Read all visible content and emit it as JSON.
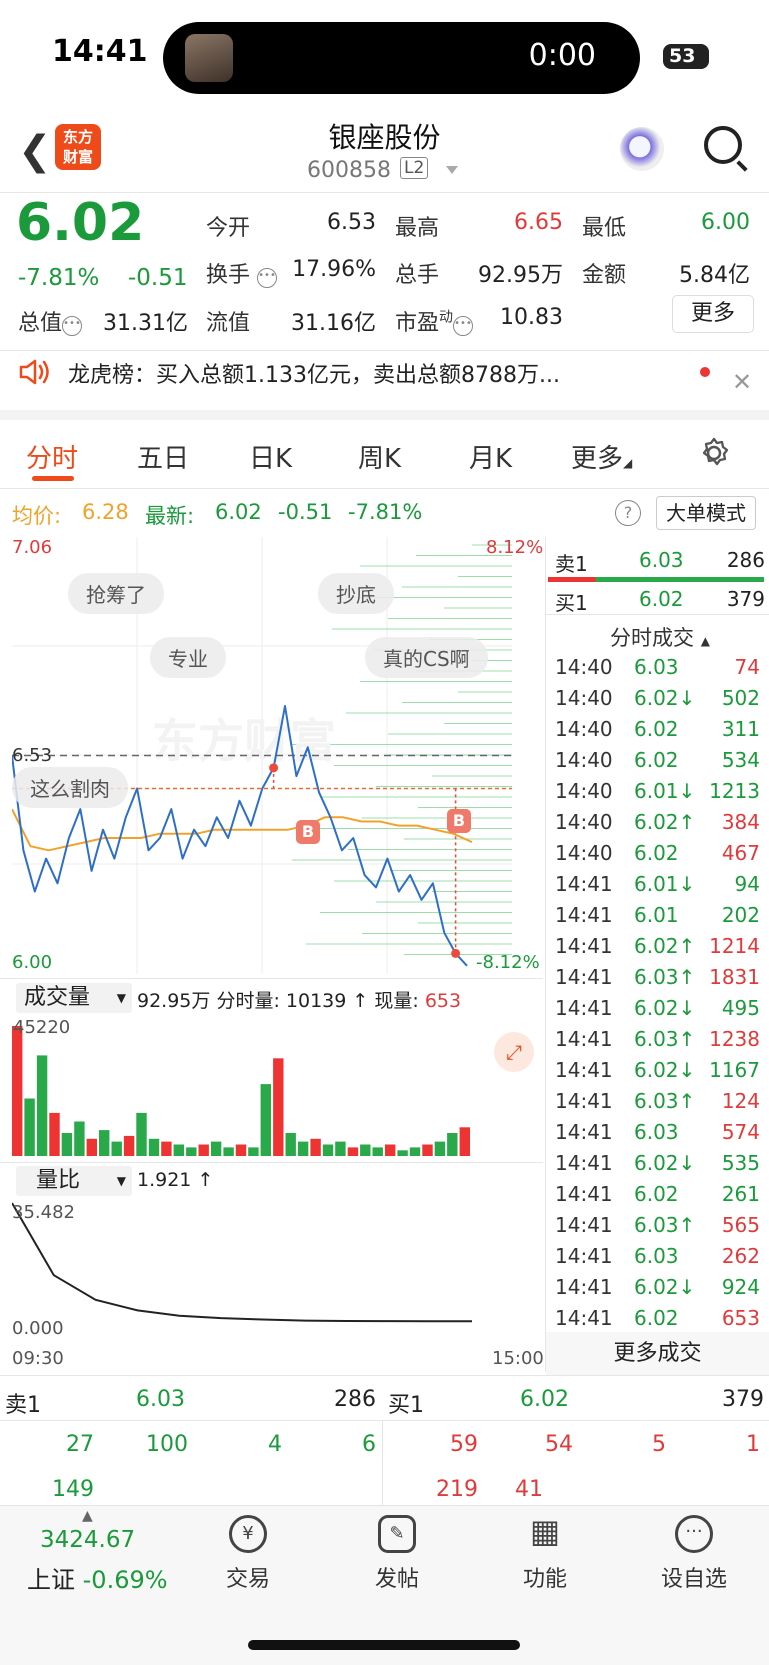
{
  "status_bar": {
    "time": "14:41",
    "timer": "0:00",
    "battery": "53"
  },
  "header": {
    "logo_line1": "东方",
    "logo_line2": "财富",
    "title": "银座股份",
    "code": "600858",
    "level": "L2"
  },
  "quote": {
    "price": "6.02",
    "change_pct": "-7.81%",
    "change": "-0.51",
    "open_label": "今开",
    "open": "6.53",
    "high_label": "最高",
    "high": "6.65",
    "low_label": "最低",
    "low": "6.00",
    "turnover_label": "换手",
    "turnover": "17.96%",
    "volume_label": "总手",
    "volume": "92.95万",
    "amount_label": "金额",
    "amount": "5.84亿",
    "mktcap_label": "总值",
    "mktcap": "31.31亿",
    "float_label": "流值",
    "float": "31.16亿",
    "pe_label": "市盈",
    "pe_sup": "动",
    "pe": "10.83",
    "more": "更多"
  },
  "notice": {
    "text": "龙虎榜：买入总额1.133亿元，卖出总额8788万..."
  },
  "tabs": [
    "分时",
    "五日",
    "日K",
    "周K",
    "月K",
    "更多"
  ],
  "chart_info": {
    "avg_label": "均价:",
    "avg": "6.28",
    "latest_label": "最新:",
    "latest": "6.02",
    "chg": "-0.51",
    "pct": "-7.81%",
    "help": "?",
    "mode": "大单模式"
  },
  "chart_labels": {
    "top_price": "7.06",
    "top_pct": "8.12%",
    "prev_close": "6.53",
    "bottom_price": "6.00",
    "bottom_pct": "-8.12%",
    "buy_marker": "B"
  },
  "bubbles": [
    "抢筹了",
    "抄底",
    "专业",
    "真的CS啊",
    "这么割肉"
  ],
  "watermark": "东方财富",
  "volume_bar": {
    "selector": "成交量",
    "total": "92.95万",
    "period_label": "分时量:",
    "period": "10139",
    "period_arrow": "↑",
    "now_label": "现量:",
    "now": "653",
    "max": "45220"
  },
  "ratio_bar": {
    "selector": "量比",
    "value": "1.921",
    "arrow": "↑",
    "max": "35.482",
    "min": "0.000"
  },
  "time_axis": {
    "start": "09:30",
    "end": "15:00"
  },
  "book": {
    "sell_label": "卖1",
    "sell_price": "6.03",
    "sell_vol": "286",
    "buy_label": "买1",
    "buy_price": "6.02",
    "buy_vol": "379"
  },
  "trades_header": "分时成交",
  "trades": [
    {
      "t": "14:40",
      "p": "6.03",
      "d": "",
      "v": "74",
      "c": "red"
    },
    {
      "t": "14:40",
      "p": "6.02",
      "d": "↓",
      "v": "502",
      "c": "green"
    },
    {
      "t": "14:40",
      "p": "6.02",
      "d": "",
      "v": "311",
      "c": "green"
    },
    {
      "t": "14:40",
      "p": "6.02",
      "d": "",
      "v": "534",
      "c": "green"
    },
    {
      "t": "14:40",
      "p": "6.01",
      "d": "↓",
      "v": "1213",
      "c": "green"
    },
    {
      "t": "14:40",
      "p": "6.02",
      "d": "↑",
      "v": "384",
      "c": "red"
    },
    {
      "t": "14:40",
      "p": "6.02",
      "d": "",
      "v": "467",
      "c": "red"
    },
    {
      "t": "14:41",
      "p": "6.01",
      "d": "↓",
      "v": "94",
      "c": "green"
    },
    {
      "t": "14:41",
      "p": "6.01",
      "d": "",
      "v": "202",
      "c": "green"
    },
    {
      "t": "14:41",
      "p": "6.02",
      "d": "↑",
      "v": "1214",
      "c": "red"
    },
    {
      "t": "14:41",
      "p": "6.03",
      "d": "↑",
      "v": "1831",
      "c": "red"
    },
    {
      "t": "14:41",
      "p": "6.02",
      "d": "↓",
      "v": "495",
      "c": "green"
    },
    {
      "t": "14:41",
      "p": "6.03",
      "d": "↑",
      "v": "1238",
      "c": "red"
    },
    {
      "t": "14:41",
      "p": "6.02",
      "d": "↓",
      "v": "1167",
      "c": "green"
    },
    {
      "t": "14:41",
      "p": "6.03",
      "d": "↑",
      "v": "124",
      "c": "red"
    },
    {
      "t": "14:41",
      "p": "6.03",
      "d": "",
      "v": "574",
      "c": "red"
    },
    {
      "t": "14:41",
      "p": "6.02",
      "d": "↓",
      "v": "535",
      "c": "green"
    },
    {
      "t": "14:41",
      "p": "6.02",
      "d": "",
      "v": "261",
      "c": "green"
    },
    {
      "t": "14:41",
      "p": "6.03",
      "d": "↑",
      "v": "565",
      "c": "red"
    },
    {
      "t": "14:41",
      "p": "6.03",
      "d": "",
      "v": "262",
      "c": "red"
    },
    {
      "t": "14:41",
      "p": "6.02",
      "d": "↓",
      "v": "924",
      "c": "green"
    },
    {
      "t": "14:41",
      "p": "6.02",
      "d": "",
      "v": "653",
      "c": "red"
    }
  ],
  "more_trades": "更多成交",
  "bottom_book": {
    "sell_label": "卖1",
    "sell_price": "6.03",
    "sell_vol": "286",
    "buy_label": "买1",
    "buy_price": "6.02",
    "buy_vol": "379",
    "sell_orders": [
      "27",
      "100",
      "4",
      "6",
      "149"
    ],
    "buy_orders": [
      "59",
      "54",
      "5",
      "1",
      "219",
      "41"
    ]
  },
  "nav": {
    "index_value": "3424.67",
    "index_name": "上证",
    "index_change": "-0.69%",
    "items": [
      {
        "label": "交易",
        "icon": "¥"
      },
      {
        "label": "发帖",
        "icon": "✎"
      },
      {
        "label": "功能",
        "icon": "▦"
      },
      {
        "label": "设自选",
        "icon": "···"
      }
    ]
  },
  "chart_data": {
    "type": "line",
    "x": [
      "09:30",
      "15:00"
    ],
    "series": [
      {
        "values": [
          6.53,
          6.3,
          6.2,
          6.28,
          6.22,
          6.33,
          6.4,
          6.25,
          6.35,
          6.28,
          6.38,
          6.45,
          6.3,
          6.33,
          6.4,
          6.28,
          6.35,
          6.31,
          6.38,
          6.33,
          6.42,
          6.36,
          6.45,
          6.5,
          6.65,
          6.48,
          6.55,
          6.44,
          6.38,
          6.3,
          6.33,
          6.24,
          6.21,
          6.28,
          6.2,
          6.24,
          6.18,
          6.22,
          6.1,
          6.05,
          6.02
        ]
      },
      {
        "values": [
          6.4,
          6.31,
          6.3,
          6.31,
          6.32,
          6.33,
          6.33,
          6.33,
          6.34,
          6.34,
          6.34,
          6.35,
          6.35,
          6.35,
          6.35,
          6.35,
          6.36,
          6.38,
          6.38,
          6.37,
          6.37,
          6.36,
          6.36,
          6.35,
          6.34,
          6.32
        ]
      }
    ],
    "prev_close": 6.53,
    "ylim": [
      6.0,
      7.06
    ],
    "volume": [
      45220,
      20000,
      35000,
      15000,
      8000,
      12000,
      6000,
      9000,
      5000,
      7000,
      15000,
      6000,
      5000,
      4000,
      3000,
      4000,
      5000,
      3000,
      4000,
      3000,
      25000,
      34000,
      8000,
      5000,
      6000,
      4000,
      5000,
      3000,
      4000,
      3000,
      4000,
      2000,
      3000,
      4000,
      5000,
      8000,
      10000
    ],
    "volume_ratio": [
      35.482,
      15,
      8,
      5,
      3.5,
      2.8,
      2.4,
      2.1,
      2.0,
      1.95,
      1.93,
      1.921
    ],
    "buy_markers": [
      {
        "time_index": 23
      },
      {
        "time_index": 39
      }
    ]
  }
}
